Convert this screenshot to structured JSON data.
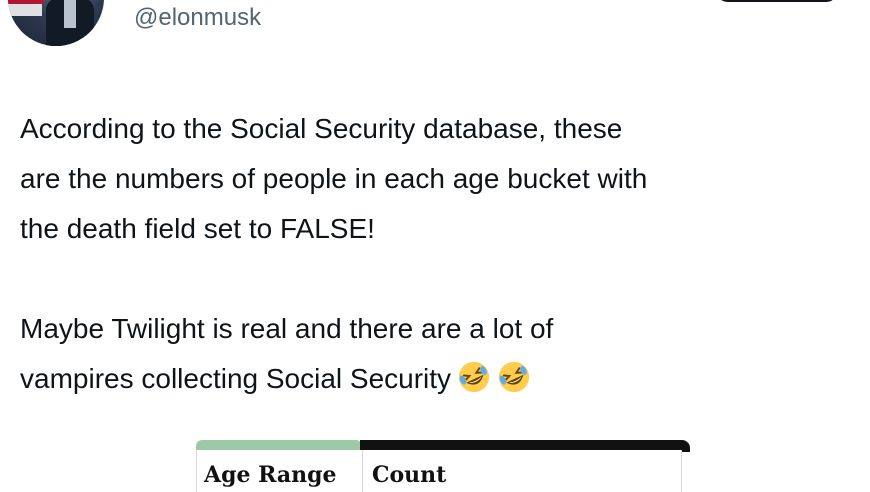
{
  "header": {
    "handle": "@elonmusk"
  },
  "tweet": {
    "paragraphs": [
      "According to the Social Security database, these\nare the numbers of people in each age bucket with\nthe death field set to FALSE!",
      "Maybe Twilight is real and there are a lot of\nvampires collecting Social Security"
    ],
    "emojis": [
      "rolling-on-the-floor-laughing-emoji",
      "rolling-on-the-floor-laughing-emoji"
    ]
  },
  "table": {
    "headers": [
      "Age Range",
      "Count"
    ],
    "colors": {
      "header_accent_left": "#9dc9a6",
      "header_accent_right": "#111111"
    }
  },
  "colors": {
    "text": "#0f1419",
    "secondary_text": "#536471",
    "background": "#ffffff"
  }
}
